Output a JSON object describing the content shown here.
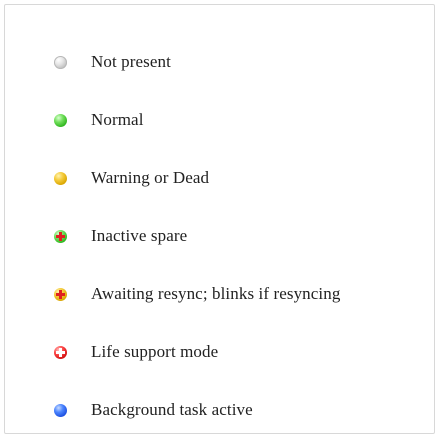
{
  "legend": {
    "items": [
      {
        "label": "Not present",
        "icon": "gray-status-dot-icon",
        "color": "#bdbdbd"
      },
      {
        "label": "Normal",
        "icon": "green-status-dot-icon",
        "color": "#2fb51f"
      },
      {
        "label": "Warning or Dead",
        "icon": "yellow-status-dot-icon",
        "color": "#d9a500"
      },
      {
        "label": "Inactive spare",
        "icon": "green-plus-dot-icon",
        "color": "#2fb51f",
        "mark_color": "#e02020"
      },
      {
        "label": "Awaiting resync; blinks if resyncing",
        "icon": "yellow-plus-dot-icon",
        "color": "#d9a500",
        "mark_color": "#e02020"
      },
      {
        "label": "Life support mode",
        "icon": "red-plus-dot-icon",
        "color": "#d01010",
        "mark_color": "#ffffff"
      },
      {
        "label": "Background task active",
        "icon": "blue-status-dot-icon",
        "color": "#1c4fe0"
      }
    ]
  }
}
